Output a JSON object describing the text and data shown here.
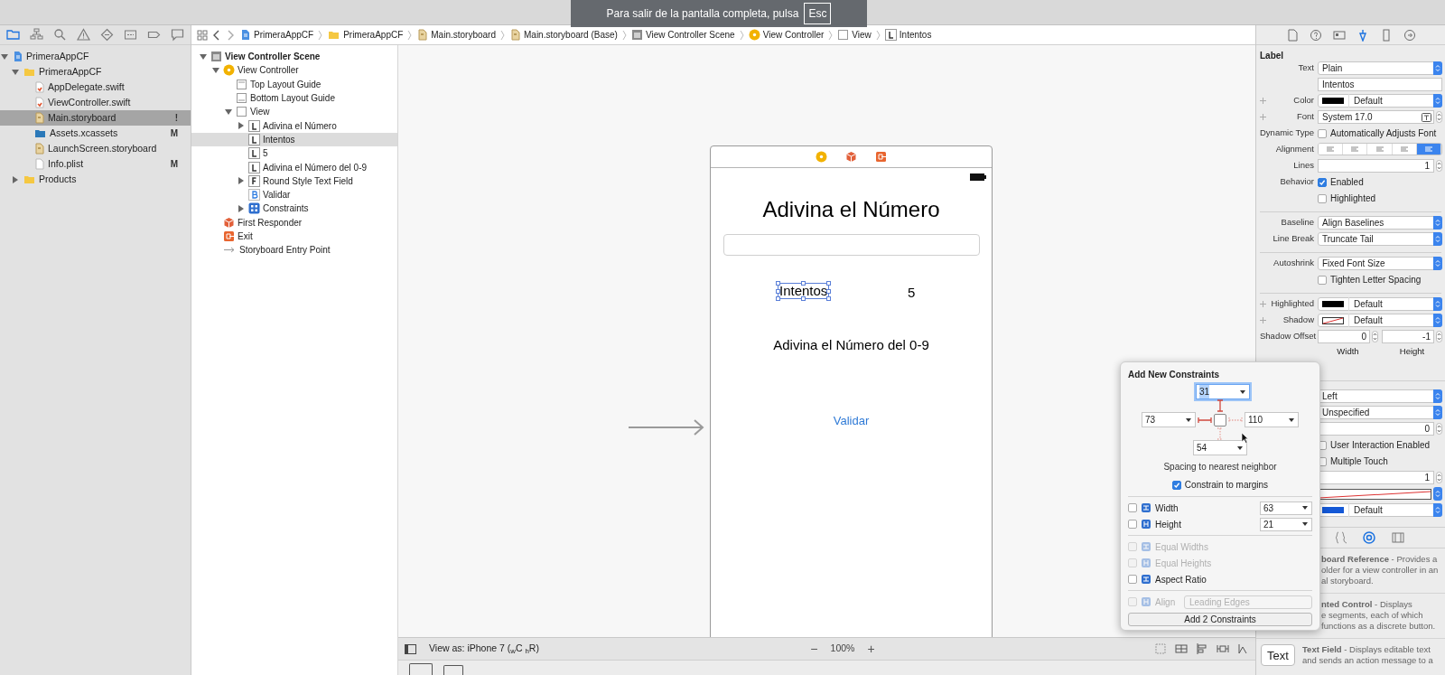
{
  "fullscreen_notice": {
    "text": "Para salir de la pantalla completa, pulsa",
    "key": "Esc"
  },
  "navigator": {
    "tabs": [
      {
        "selected": true
      },
      {
        "selected": false
      },
      {
        "selected": false
      },
      {
        "selected": false
      },
      {
        "selected": false
      },
      {
        "selected": false
      },
      {
        "selected": false
      },
      {
        "selected": false
      }
    ],
    "tree": [
      {
        "kind": "project",
        "label": "PrimeraAppCF",
        "expanded": true,
        "selected": false,
        "children": [
          {
            "kind": "folder",
            "label": "PrimeraAppCF",
            "expanded": true,
            "selected": false,
            "children": [
              {
                "kind": "code",
                "label": "AppDelegate.swift",
                "selected": false
              },
              {
                "kind": "code",
                "label": "ViewController.swift",
                "selected": false
              },
              {
                "kind": "storyboard",
                "label": "Main.storyboard",
                "selected": true,
                "badge": "!"
              },
              {
                "kind": "assets",
                "label": "Assets.xcassets",
                "selected": false,
                "badge": "M"
              },
              {
                "kind": "storyboard",
                "label": "LaunchScreen.storyboard",
                "selected": false
              },
              {
                "kind": "plist",
                "label": "Info.plist",
                "selected": false,
                "badge": "M"
              }
            ]
          },
          {
            "kind": "folder",
            "label": "Products",
            "expanded": false,
            "selected": false
          }
        ]
      }
    ]
  },
  "breadcrumb": [
    {
      "kind": "project",
      "label": "PrimeraAppCF"
    },
    {
      "kind": "folder",
      "label": "PrimeraAppCF"
    },
    {
      "kind": "storyboard",
      "label": "Main.storyboard"
    },
    {
      "kind": "storyboard",
      "label": "Main.storyboard (Base)"
    },
    {
      "kind": "scene",
      "label": "View Controller Scene"
    },
    {
      "kind": "controller",
      "label": "View Controller"
    },
    {
      "kind": "view",
      "label": "View"
    },
    {
      "kind": "label",
      "label": "Intentos"
    }
  ],
  "outline": [
    {
      "kind": "scene",
      "label": "View Controller Scene",
      "expanded": true,
      "selected": false,
      "children": [
        {
          "kind": "controller",
          "label": "View Controller",
          "expanded": true,
          "selected": false,
          "children": [
            {
              "kind": "guide_top",
              "label": "Top Layout Guide",
              "selected": false
            },
            {
              "kind": "guide_bottom",
              "label": "Bottom Layout Guide",
              "selected": false
            },
            {
              "kind": "view",
              "label": "View",
              "expanded": true,
              "selected": false,
              "children": [
                {
                  "kind": "label",
                  "label": "Adivina el Número",
                  "expanded": false,
                  "selected": false
                },
                {
                  "kind": "label",
                  "label": "Intentos",
                  "selected": true
                },
                {
                  "kind": "label",
                  "label": "5",
                  "selected": false
                },
                {
                  "kind": "label",
                  "label": "Adivina el Número del 0-9",
                  "selected": false
                },
                {
                  "kind": "field",
                  "label": "Round Style Text Field",
                  "expanded": false,
                  "selected": false
                },
                {
                  "kind": "button",
                  "label": "Validar",
                  "selected": false
                },
                {
                  "kind": "constraints",
                  "label": "Constraints",
                  "expanded": false,
                  "selected": false
                }
              ]
            }
          ]
        },
        {
          "kind": "responder",
          "label": "First Responder",
          "selected": false
        },
        {
          "kind": "exit",
          "label": "Exit",
          "selected": false
        },
        {
          "kind": "entry",
          "label": "Storyboard Entry Point",
          "selected": false
        }
      ]
    }
  ],
  "scene": {
    "title": "Adivina el Número",
    "label": {
      "text": "Intentos",
      "selected": true
    },
    "count": "5",
    "subtitle": "Adivina el Número del 0-9",
    "button": "Validar"
  },
  "bottom_bar": {
    "device": "View as: iPhone 7 ($_{w}$C $_{h}$R)",
    "zoom_out": "−",
    "zoom": "100%",
    "zoom_in": "+"
  },
  "inspector": {
    "tabs": [
      {
        "selected": false
      },
      {
        "selected": false
      },
      {
        "selected": false
      },
      {
        "selected": true
      },
      {
        "selected": false
      },
      {
        "selected": false
      }
    ],
    "section": "Label",
    "rows": [
      {
        "kind": "popup",
        "label": "Text",
        "value": "Plain"
      },
      {
        "kind": "text",
        "value": "Intentos"
      },
      {
        "kind": "color",
        "label": "Color",
        "value": "Default",
        "color": "#000000",
        "plus": true
      },
      {
        "kind": "font",
        "label": "Font",
        "value": "System 17.0",
        "plus": true
      },
      {
        "kind": "check",
        "label": "Dynamic Type",
        "value": "Automatically Adjusts Font",
        "checked": false
      },
      {
        "kind": "segments",
        "label": "Alignment",
        "segments": [
          {
            "selected": false
          },
          {
            "selected": false
          },
          {
            "selected": false
          },
          {
            "selected": false
          },
          {
            "selected": true
          }
        ]
      },
      {
        "kind": "number",
        "label": "Lines",
        "value": "1"
      },
      {
        "kind": "check",
        "label": "Behavior",
        "value": "Enabled",
        "checked": true
      },
      {
        "kind": "check",
        "value": "Highlighted",
        "checked": false
      },
      {
        "kind": "divider"
      },
      {
        "kind": "popup",
        "label": "Baseline",
        "value": "Align Baselines"
      },
      {
        "kind": "popup",
        "label": "Line Break",
        "value": "Truncate Tail"
      },
      {
        "kind": "divider"
      },
      {
        "kind": "popup",
        "label": "Autoshrink",
        "value": "Fixed Font Size"
      },
      {
        "kind": "check",
        "value": "Tighten Letter Spacing",
        "checked": false
      },
      {
        "kind": "divider"
      },
      {
        "kind": "color",
        "label": "Highlighted",
        "value": "Default",
        "color": "#000000",
        "plus": true
      },
      {
        "kind": "shadow",
        "label": "Shadow",
        "value": "Default",
        "plus": true
      },
      {
        "kind": "offset",
        "label": "Shadow Offset",
        "values": [
          "0",
          "-1"
        ],
        "captions": [
          "Width",
          "Height"
        ]
      }
    ],
    "more_rows": [
      {
        "kind": "popup",
        "value": "Left"
      },
      {
        "kind": "popup",
        "value": "Unspecified"
      },
      {
        "kind": "number",
        "value": "0"
      },
      {
        "kind": "check",
        "value": "User Interaction Enabled",
        "checked": false
      },
      {
        "kind": "check",
        "value": "Multiple Touch",
        "checked": false
      },
      {
        "kind": "number",
        "value": "1"
      },
      {
        "kind": "shadow_bar"
      },
      {
        "kind": "color",
        "value": "Default",
        "color": "#1458d6"
      }
    ],
    "library_tabs": [
      {
        "selected": false
      },
      {
        "selected": true
      },
      {
        "selected": false
      }
    ],
    "library": [
      {
        "kind": "partial",
        "lines": [
          "**board Reference** - Provides a",
          "older for a view controller in an",
          "al storyboard."
        ]
      },
      {
        "kind": "partial",
        "lines": [
          "**nted Control** - Displays",
          "e segments, each of which",
          "functions as a discrete button."
        ]
      },
      {
        "kind": "textfield",
        "icon_text": "Text",
        "lines": [
          "**Text Field** - Displays editable text",
          "and sends an action message to a"
        ]
      }
    ]
  },
  "constraints_popover": {
    "title": "Add New Constraints",
    "spacing": {
      "top": {
        "value": "31",
        "on": true,
        "focused": true
      },
      "left": {
        "value": "73",
        "on": true,
        "focused": false
      },
      "right": {
        "value": "110",
        "on": false,
        "focused": false
      },
      "bottom": {
        "value": "54",
        "on": false,
        "focused": false
      }
    },
    "spacing_caption": "Spacing to nearest neighbor",
    "margins": {
      "label": "Constrain to margins",
      "checked": true
    },
    "options": [
      {
        "kind": "size",
        "label": "Width",
        "value": "63",
        "checked": false,
        "disabled": false
      },
      {
        "kind": "size",
        "label": "Height",
        "value": "21",
        "checked": false,
        "disabled": false
      },
      {
        "kind": "plain",
        "label": "Equal Widths",
        "checked": false,
        "disabled": true
      },
      {
        "kind": "plain",
        "label": "Equal Heights",
        "checked": false,
        "disabled": true
      },
      {
        "kind": "plain",
        "label": "Aspect Ratio",
        "checked": false,
        "disabled": false
      },
      {
        "kind": "align",
        "label": "Align",
        "value": "Leading Edges",
        "checked": false,
        "disabled": true
      }
    ],
    "button": "Add 2 Constraints"
  }
}
